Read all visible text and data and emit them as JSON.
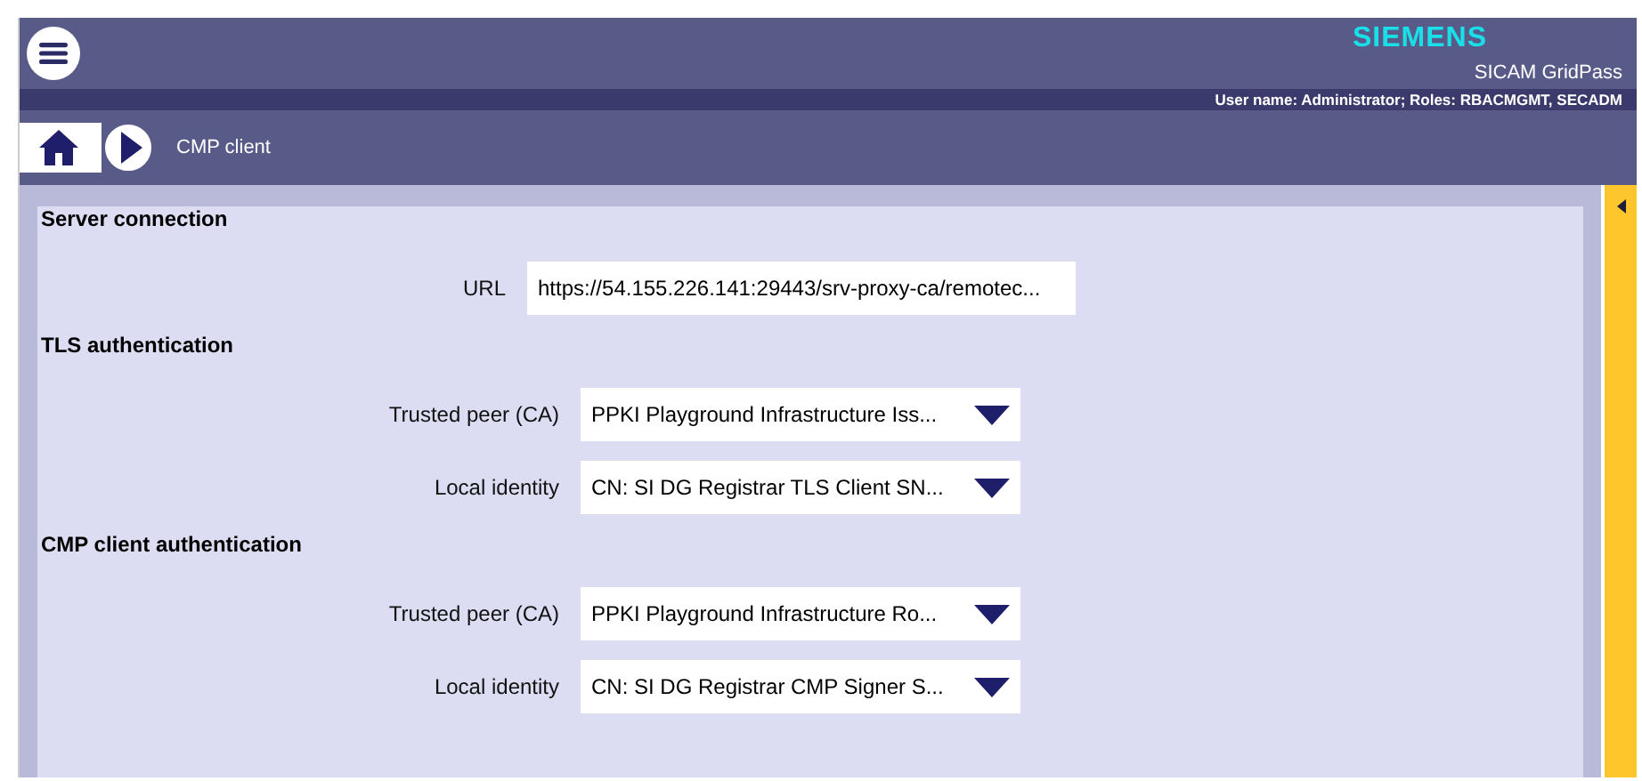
{
  "header": {
    "brand": "SIEMENS",
    "product": "SICAM GridPass",
    "user_info": "User name: Administrator; Roles: RBACMGMT, SECADM"
  },
  "breadcrumb": {
    "page": "CMP client"
  },
  "sections": [
    {
      "title": "Server connection",
      "fields": [
        {
          "kind": "text",
          "label": "URL",
          "value": "https://54.155.226.141:29443/srv-proxy-ca/remotec..."
        }
      ]
    },
    {
      "title": "TLS authentication",
      "fields": [
        {
          "kind": "select",
          "label": "Trusted peer (CA)",
          "value": "PPKI Playground Infrastructure Iss..."
        },
        {
          "kind": "select",
          "label": "Local identity",
          "value": "CN: SI DG Registrar TLS Client SN..."
        }
      ]
    },
    {
      "title": "CMP client authentication",
      "fields": [
        {
          "kind": "select",
          "label": "Trusted peer (CA)",
          "value": "PPKI Playground Infrastructure Ro..."
        },
        {
          "kind": "select",
          "label": "Local identity",
          "value": "CN: SI DG Registrar CMP Signer S..."
        }
      ]
    }
  ]
}
